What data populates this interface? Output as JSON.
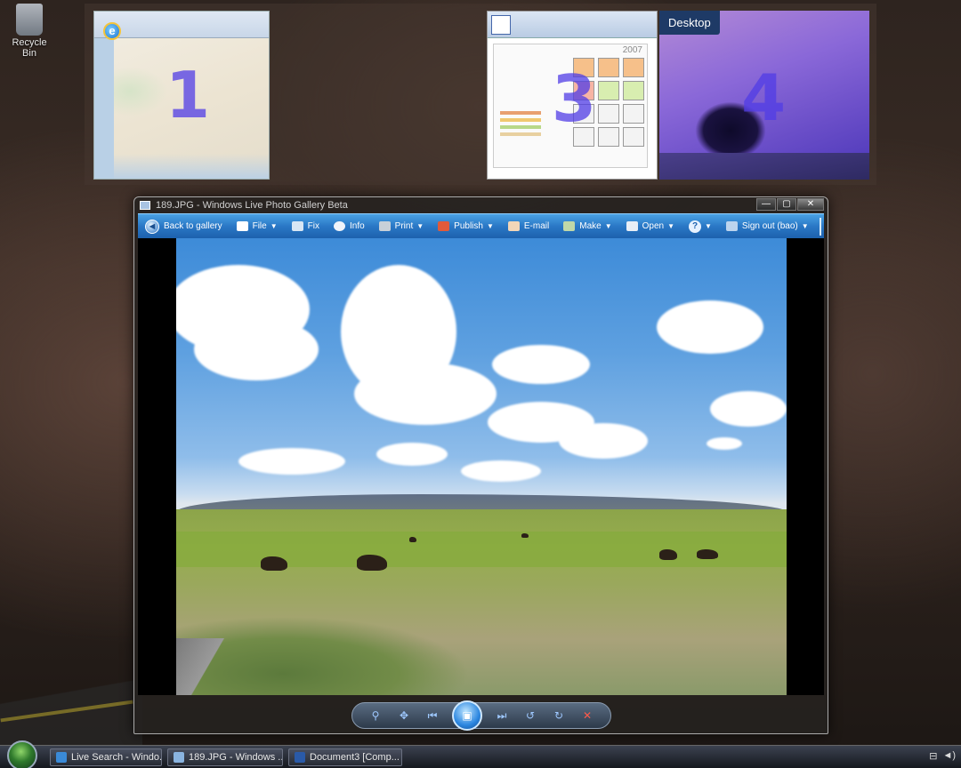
{
  "desktop": {
    "recycle_bin_label": "Recycle Bin"
  },
  "virtual_desktops": {
    "items": [
      {
        "number": "1",
        "app": "Windows Live Search maps in Internet Explorer"
      },
      {
        "number": "3",
        "app": "Microsoft Word document with 2007 calendar"
      },
      {
        "number": "4",
        "app": "Desktop"
      }
    ],
    "desktop_label": "Desktop",
    "calendar_year": "2007"
  },
  "photo_gallery": {
    "window_title": "189.JPG - Windows Live Photo Gallery Beta",
    "window_controls": {
      "minimize": "—",
      "maximize": "▢",
      "close": "✕"
    },
    "toolbar": {
      "back": "Back to gallery",
      "file": "File",
      "fix": "Fix",
      "info": "Info",
      "print": "Print",
      "publish": "Publish",
      "email": "E-mail",
      "make": "Make",
      "open": "Open",
      "help": "?",
      "sign_out": "Sign out (bao)"
    },
    "controls": {
      "zoom": "⚲",
      "actual_size": "✥",
      "previous": "⏮",
      "slideshow": "▣",
      "next": "⏭",
      "rotate_ccw": "↺",
      "rotate_cw": "↻",
      "delete": "✕"
    }
  },
  "taskbar": {
    "buttons": [
      {
        "label": "Live Search - Windo...",
        "icon": "ie-icon"
      },
      {
        "label": "189.JPG - Windows ...",
        "icon": "photo-gallery-icon"
      },
      {
        "label": "Document3 [Comp...",
        "icon": "word-icon"
      }
    ],
    "tray": {
      "network": "⊟",
      "volume": "◄)"
    }
  }
}
